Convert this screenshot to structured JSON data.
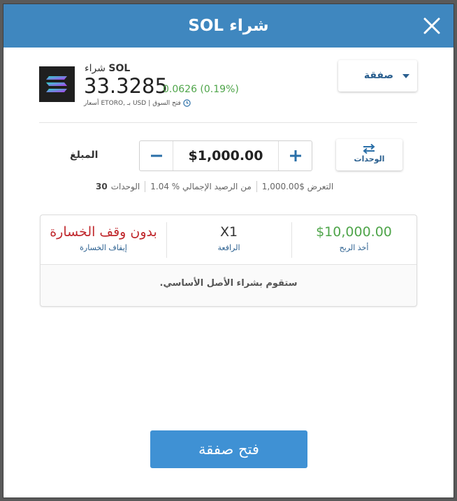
{
  "window": {
    "title": "شراء SOL"
  },
  "asset": {
    "action": "شراء",
    "symbol": "SOL",
    "price": "33.3285",
    "change": "0.0626 (0.19%)",
    "market_status": "فتح السوق",
    "currency": "USD",
    "source": "ETORO, بـ",
    "prices_label": "أسعار"
  },
  "trade_type": {
    "label": "صفقة"
  },
  "amount": {
    "label": "المبلغ",
    "value": "$1,000.00",
    "units_label": "الوحدات"
  },
  "stats": {
    "exposure": "التعرض $1,000.00",
    "balance_pct": "من الرصيد الإجمالي % 1.04",
    "units_label": "الوحدات",
    "units_value": "30"
  },
  "panel": {
    "stop_loss": {
      "value": "بدون وقف الخسارة",
      "label": "إيقاف الخسارة"
    },
    "leverage": {
      "value": "X1",
      "label": "الرافعة"
    },
    "take_profit": {
      "value": "$10,000.00",
      "label": "أخذ الربح"
    },
    "note": ".ستقوم بشراء الأصل الأساسي"
  },
  "open_button": {
    "label": "فتح صفقة"
  },
  "colors": {
    "header": "#3f87bf",
    "accent": "#2a5f8f",
    "positive": "#4fa54a",
    "negative": "#c0282d",
    "primary_button": "#3f91d4"
  },
  "icons": {
    "close": "close-icon",
    "logo": "solana-logo-icon",
    "clock": "clock-icon",
    "caret": "chevron-down-icon",
    "swap": "swap-arrows-icon",
    "minus": "minus-icon",
    "plus": "plus-icon"
  }
}
